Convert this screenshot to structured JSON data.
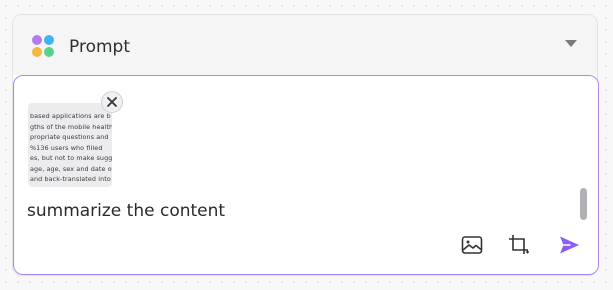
{
  "header": {
    "title": "Prompt",
    "logo_icon": "four-dots-logo",
    "logo_colors": [
      "#b47cf0",
      "#3db5f5",
      "#5bd08a",
      "#f5b73d"
    ]
  },
  "attachment": {
    "thumbnail_lines": [
      "based applications are b",
      "gths of the mobile health",
      "propriate questions and",
      "%136 users who filled",
      "es, but not to make sugg",
      "age, age, sex and date of",
      "and back-translated into"
    ],
    "remove_icon": "close-icon"
  },
  "input": {
    "value": "summarize the content"
  },
  "toolbar": {
    "image_icon": "image-icon",
    "crop_icon": "crop-icon",
    "send_icon": "send-icon"
  },
  "colors": {
    "accent": "#8b5cf6",
    "border_focus": "#a98af0"
  }
}
